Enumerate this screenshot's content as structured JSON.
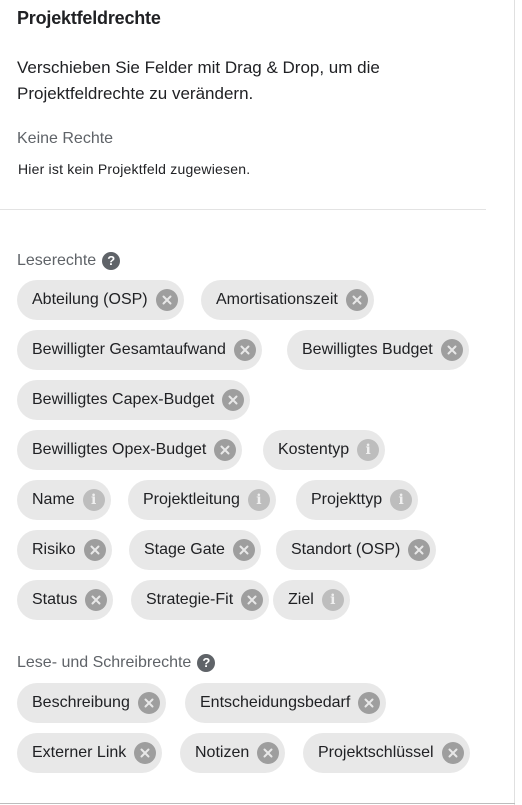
{
  "title": "Projektfeldrechte",
  "description": "Verschieben Sie Felder mit Drag & Drop, um die Projektfeldrechte zu verändern.",
  "no_rights": {
    "label": "Keine Rechte",
    "hint": "Hier ist kein Projektfeld zugewiesen."
  },
  "read_rights": {
    "label": "Leserechte",
    "help": "?",
    "chips": [
      {
        "label": "Abteilung (OSP)",
        "icon": "remove-icon"
      },
      {
        "label": "Amortisationszeit",
        "icon": "remove-icon"
      },
      {
        "label": "Bewilligter Gesamtaufwand",
        "icon": "remove-icon"
      },
      {
        "label": "Bewilligtes Budget",
        "icon": "remove-icon"
      },
      {
        "label": "Bewilligtes Capex-Budget",
        "icon": "remove-icon"
      },
      {
        "label": "Bewilligtes Opex-Budget",
        "icon": "remove-icon"
      },
      {
        "label": "Kostentyp",
        "icon": "info-icon"
      },
      {
        "label": "Name",
        "icon": "info-icon"
      },
      {
        "label": "Projektleitung",
        "icon": "info-icon"
      },
      {
        "label": "Projekttyp",
        "icon": "info-icon"
      },
      {
        "label": "Risiko",
        "icon": "remove-icon"
      },
      {
        "label": "Stage Gate",
        "icon": "remove-icon"
      },
      {
        "label": "Standort (OSP)",
        "icon": "remove-icon"
      },
      {
        "label": "Status",
        "icon": "remove-icon"
      },
      {
        "label": "Strategie-Fit",
        "icon": "remove-icon"
      },
      {
        "label": "Ziel",
        "icon": "info-icon"
      }
    ]
  },
  "read_write_rights": {
    "label": "Lese- und Schreibrechte",
    "help": "?",
    "chips": [
      {
        "label": "Beschreibung",
        "icon": "remove-icon"
      },
      {
        "label": "Entscheidungsbedarf",
        "icon": "remove-icon"
      },
      {
        "label": "Externer Link",
        "icon": "remove-icon"
      },
      {
        "label": "Notizen",
        "icon": "remove-icon"
      },
      {
        "label": "Projektschlüssel",
        "icon": "remove-icon"
      }
    ]
  }
}
